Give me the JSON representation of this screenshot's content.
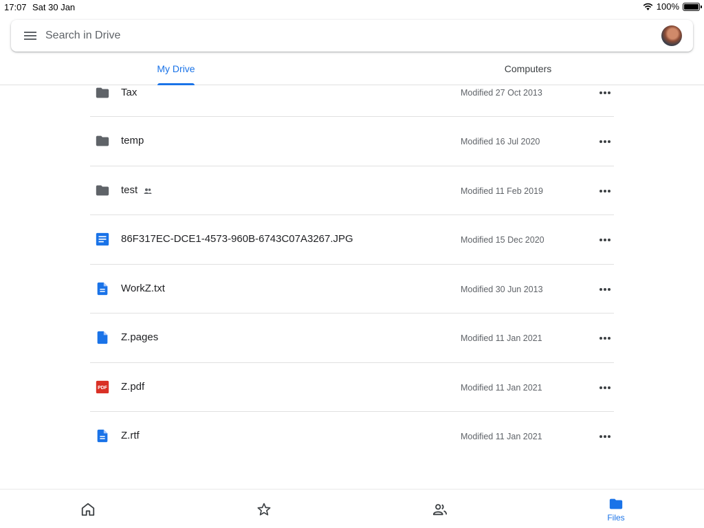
{
  "status": {
    "time": "17:07",
    "date": "Sat 30 Jan",
    "battery": "100%"
  },
  "search": {
    "placeholder": "Search in Drive"
  },
  "tabs": [
    {
      "label": "My Drive",
      "active": true
    },
    {
      "label": "Computers",
      "active": false
    }
  ],
  "files": [
    {
      "name": "Tax",
      "modified": "Modified 27 Oct 2013",
      "icon": "folder-icon",
      "shared": false
    },
    {
      "name": "temp",
      "modified": "Modified 16 Jul 2020",
      "icon": "folder-icon",
      "shared": false
    },
    {
      "name": "test",
      "modified": "Modified 11 Feb 2019",
      "icon": "folder-icon",
      "shared": true
    },
    {
      "name": "86F317EC-DCE1-4573-960B-6743C07A3267.JPG",
      "modified": "Modified 15 Dec 2020",
      "icon": "google-doc-icon",
      "shared": false
    },
    {
      "name": "WorkZ.txt",
      "modified": "Modified 30 Jun 2013",
      "icon": "document-icon",
      "shared": false
    },
    {
      "name": "Z.pages",
      "modified": "Modified 11 Jan 2021",
      "icon": "file-icon",
      "shared": false
    },
    {
      "name": "Z.pdf",
      "modified": "Modified 11 Jan 2021",
      "icon": "pdf-icon",
      "shared": false
    },
    {
      "name": "Z.rtf",
      "modified": "Modified 11 Jan 2021",
      "icon": "document-icon",
      "shared": false
    }
  ],
  "pdf_icon_text": "PDF",
  "bottom_nav": [
    {
      "icon": "home-icon",
      "label": ""
    },
    {
      "icon": "star-icon",
      "label": ""
    },
    {
      "icon": "shared-people-icon",
      "label": ""
    },
    {
      "icon": "files-folder-icon",
      "label": "Files",
      "active": true
    }
  ],
  "colors": {
    "accent": "#1a73e8",
    "folder": "#5f6368",
    "doc_blue": "#1a73e8",
    "pdf_red": "#d93025",
    "divider": "#e0e0e0"
  }
}
